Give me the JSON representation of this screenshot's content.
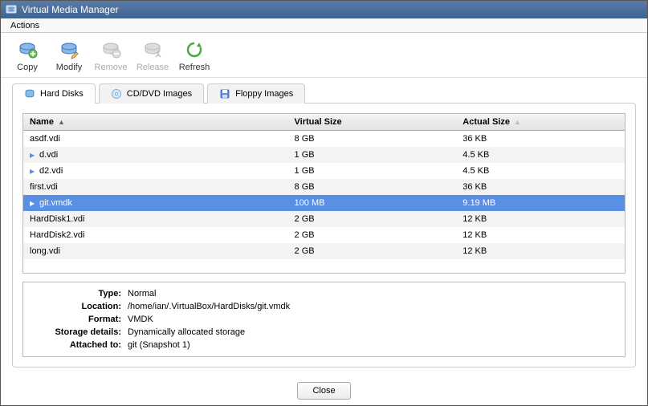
{
  "window": {
    "title": "Virtual Media Manager"
  },
  "menubar": {
    "actions": "Actions"
  },
  "toolbar": {
    "copy": "Copy",
    "modify": "Modify",
    "remove": "Remove",
    "release": "Release",
    "refresh": "Refresh"
  },
  "tabs": {
    "hard_disks": "Hard Disks",
    "cd_dvd": "CD/DVD Images",
    "floppy": "Floppy Images"
  },
  "table": {
    "headers": {
      "name": "Name",
      "virtual_size": "Virtual Size",
      "actual_size": "Actual Size"
    },
    "rows": [
      {
        "name": "asdf.vdi",
        "vsize": "8 GB",
        "asize": "36 KB",
        "expandable": false,
        "selected": false,
        "indent": false
      },
      {
        "name": "d.vdi",
        "vsize": "1 GB",
        "asize": "4.5 KB",
        "expandable": true,
        "selected": false,
        "indent": true
      },
      {
        "name": "d2.vdi",
        "vsize": "1 GB",
        "asize": "4.5 KB",
        "expandable": true,
        "selected": false,
        "indent": true
      },
      {
        "name": "first.vdi",
        "vsize": "8 GB",
        "asize": "36 KB",
        "expandable": false,
        "selected": false,
        "indent": false
      },
      {
        "name": "git.vmdk",
        "vsize": "100 MB",
        "asize": "9.19 MB",
        "expandable": true,
        "selected": true,
        "indent": true
      },
      {
        "name": "HardDisk1.vdi",
        "vsize": "2 GB",
        "asize": "12 KB",
        "expandable": false,
        "selected": false,
        "indent": false
      },
      {
        "name": "HardDisk2.vdi",
        "vsize": "2 GB",
        "asize": "12 KB",
        "expandable": false,
        "selected": false,
        "indent": false
      },
      {
        "name": "long.vdi",
        "vsize": "2 GB",
        "asize": "12 KB",
        "expandable": false,
        "selected": false,
        "indent": false
      }
    ]
  },
  "details": {
    "labels": {
      "type": "Type:",
      "location": "Location:",
      "format": "Format:",
      "storage_details": "Storage details:",
      "attached_to": "Attached to:"
    },
    "values": {
      "type": "Normal",
      "location": "/home/ian/.VirtualBox/HardDisks/git.vmdk",
      "format": "VMDK",
      "storage_details": "Dynamically allocated storage",
      "attached_to": "git (Snapshot 1)"
    }
  },
  "buttons": {
    "close": "Close"
  }
}
